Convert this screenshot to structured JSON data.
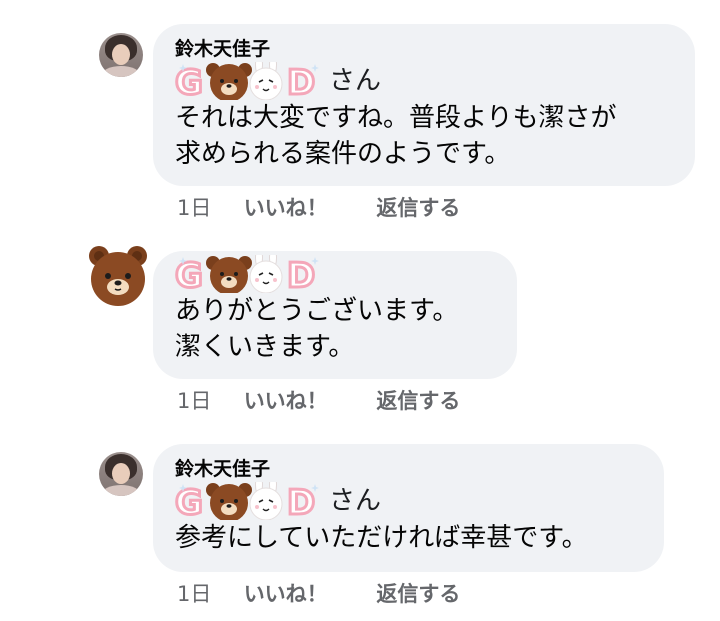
{
  "sticker_text": "GOOD",
  "comments": [
    {
      "author": "鈴木天佳子",
      "mention_suffix": "さん",
      "lines": [
        "それは大変ですね。普段よりも潔さが",
        "求められる案件のようです。"
      ],
      "time": "1日",
      "like_label": "いいね！",
      "reply_label": "返信する"
    },
    {
      "lines": [
        "ありがとうございます。",
        "潔くいきます。"
      ],
      "time": "1日",
      "like_label": "いいね！",
      "reply_label": "返信する"
    },
    {
      "author": "鈴木天佳子",
      "mention_suffix": "さん",
      "lines": [
        "参考にしていただければ幸甚です。"
      ],
      "time": "1日",
      "like_label": "いいね！",
      "reply_label": "返信する"
    }
  ],
  "colors": {
    "bubble": "#f0f2f5",
    "meta_text": "#65676b",
    "bear_brown": "#8b4a23",
    "sticker_pink": "#f4a7b9"
  }
}
